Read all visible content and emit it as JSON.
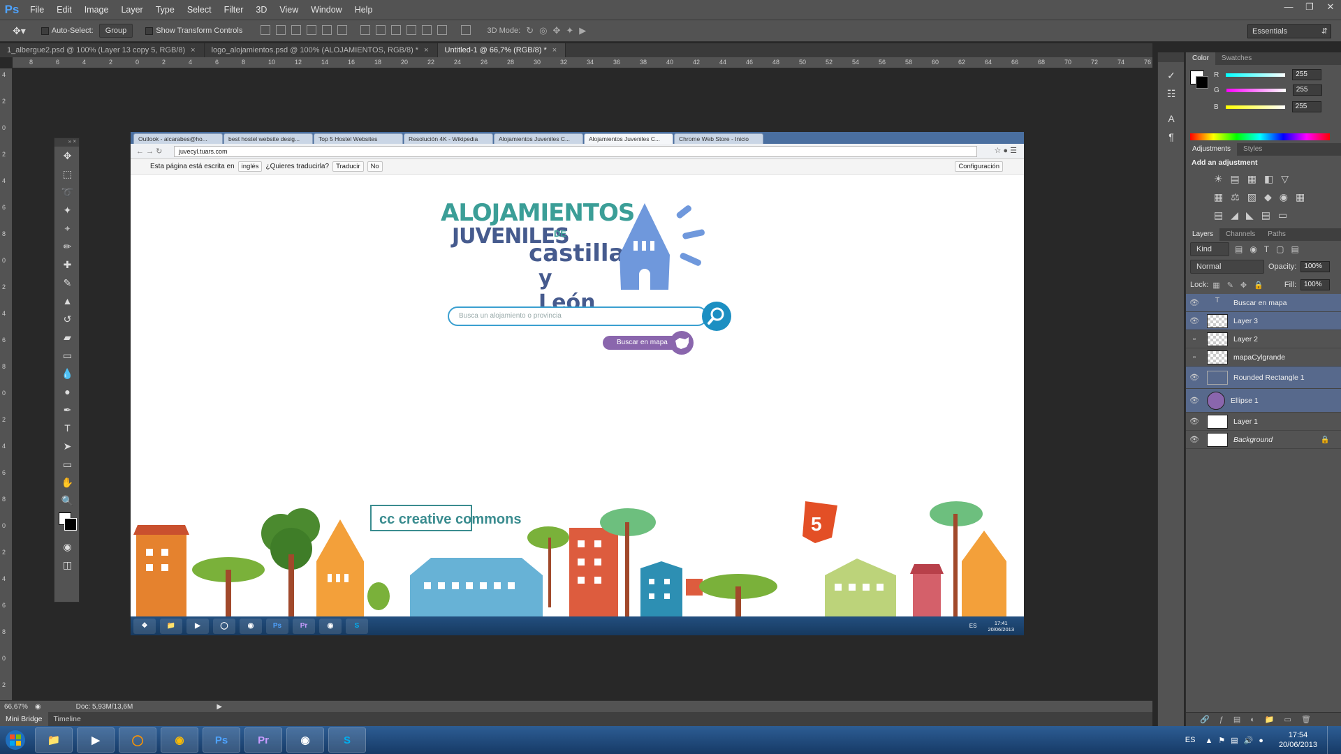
{
  "app": {
    "logo": "Ps"
  },
  "menu": [
    "File",
    "Edit",
    "Image",
    "Layer",
    "Type",
    "Select",
    "Filter",
    "3D",
    "View",
    "Window",
    "Help"
  ],
  "options": {
    "auto_select": "Auto-Select:",
    "group": "Group",
    "transform": "Show Transform Controls",
    "mode3d": "3D Mode:",
    "workspace": "Essentials"
  },
  "doc_tabs": [
    {
      "label": "1_albergue2.psd @ 100% (Layer 13 copy 5, RGB/8)",
      "active": false
    },
    {
      "label": "logo_alojamientos.psd @ 100% (ALOJAMIENTOS, RGB/8) *",
      "active": false
    },
    {
      "label": "Untitled-1 @ 66,7% (RGB/8) *",
      "active": true
    }
  ],
  "ruler_h": [
    "8",
    "6",
    "4",
    "2",
    "0",
    "2",
    "4",
    "6",
    "8",
    "10",
    "12",
    "14",
    "16",
    "18",
    "20",
    "22",
    "24",
    "26",
    "28",
    "30",
    "32",
    "34",
    "36",
    "38",
    "40",
    "42",
    "44",
    "46",
    "48",
    "50",
    "52",
    "54",
    "56",
    "58",
    "60",
    "62",
    "64",
    "66",
    "68",
    "70",
    "72",
    "74",
    "76"
  ],
  "ruler_v": [
    "4",
    "2",
    "0",
    "2",
    "4",
    "6",
    "8",
    "0",
    "2",
    "4",
    "6",
    "8",
    "0",
    "2",
    "4",
    "6",
    "8",
    "0",
    "2",
    "4",
    "6",
    "8",
    "0",
    "2",
    "4"
  ],
  "browser": {
    "tabs": [
      {
        "label": "Outlook - alcarabes@ho...",
        "active": false
      },
      {
        "label": "best hostel website desig...",
        "active": false
      },
      {
        "label": "Top 5 Hostel Websites",
        "active": false
      },
      {
        "label": "Resolución 4K - Wikipedia",
        "active": false
      },
      {
        "label": "Alojamientos Juveniles C...",
        "active": false
      },
      {
        "label": "Alojamientos Juveniles C...",
        "active": true
      },
      {
        "label": "Chrome Web Store - Inicio",
        "active": false
      }
    ],
    "url": "juvecyl.tuars.com",
    "translate": {
      "text1": "Esta página está escrita en",
      "lang": "inglés",
      "text2": "¿Quieres traducirla?",
      "translate_btn": "Traducir",
      "no_btn": "No",
      "config": "Configuración"
    },
    "logo": {
      "line1": "ALOJAMIENTOS",
      "line2": "JUVENILES",
      "de": "DE",
      "line3": "castilla",
      "line4": "y León"
    },
    "search_placeholder": "Busca un alojamiento o provincia",
    "map_button": "Buscar en mapa",
    "cc": "creative commons",
    "taskbar": {
      "lang": "ES",
      "time": "17:41",
      "date": "20/06/2013"
    }
  },
  "panels": {
    "color_tabs": [
      "Color",
      "Swatches"
    ],
    "rgb": [
      {
        "ch": "R",
        "val": "255"
      },
      {
        "ch": "G",
        "val": "255"
      },
      {
        "ch": "B",
        "val": "255"
      }
    ],
    "adj_tabs": [
      "Adjustments",
      "Styles"
    ],
    "adj_title": "Add an adjustment",
    "layer_tabs": [
      "Layers",
      "Channels",
      "Paths"
    ],
    "kind": "Kind",
    "blend": "Normal",
    "opacity_label": "Opacity:",
    "opacity": "100%",
    "lock_label": "Lock:",
    "fill_label": "Fill:",
    "fill": "100%",
    "layers": [
      {
        "name": "Buscar en mapa",
        "visible": true,
        "sel": true,
        "thumb": "text"
      },
      {
        "name": "Layer 3",
        "visible": true,
        "sel": true,
        "thumb": "chk"
      },
      {
        "name": "Layer 2",
        "visible": false,
        "sel": false,
        "thumb": "chk"
      },
      {
        "name": "mapaCylgrande",
        "visible": false,
        "sel": false,
        "thumb": "chk"
      },
      {
        "name": "Rounded Rectangle 1",
        "visible": true,
        "sel": true,
        "thumb": "shape"
      },
      {
        "name": "Ellipse 1",
        "visible": true,
        "sel": true,
        "thumb": "ellipse"
      },
      {
        "name": "Layer 1",
        "visible": true,
        "sel": false,
        "thumb": "img"
      },
      {
        "name": "Background",
        "visible": true,
        "sel": false,
        "thumb": "white"
      }
    ]
  },
  "status": {
    "zoom": "66,67%",
    "doc": "Doc: 5,93M/13,6M"
  },
  "bottom_tabs": [
    "Mini Bridge",
    "Timeline"
  ],
  "taskbar": {
    "lang": "ES",
    "time": "17:54",
    "date": "20/06/2013",
    "apps": [
      "explorer",
      "media",
      "firefox",
      "chrome",
      "Ps",
      "Pr",
      "app",
      "Skype"
    ]
  },
  "colors": {
    "accent": "#1c8fc2",
    "purple": "#8a66ad",
    "ps_bg": "#535353"
  }
}
